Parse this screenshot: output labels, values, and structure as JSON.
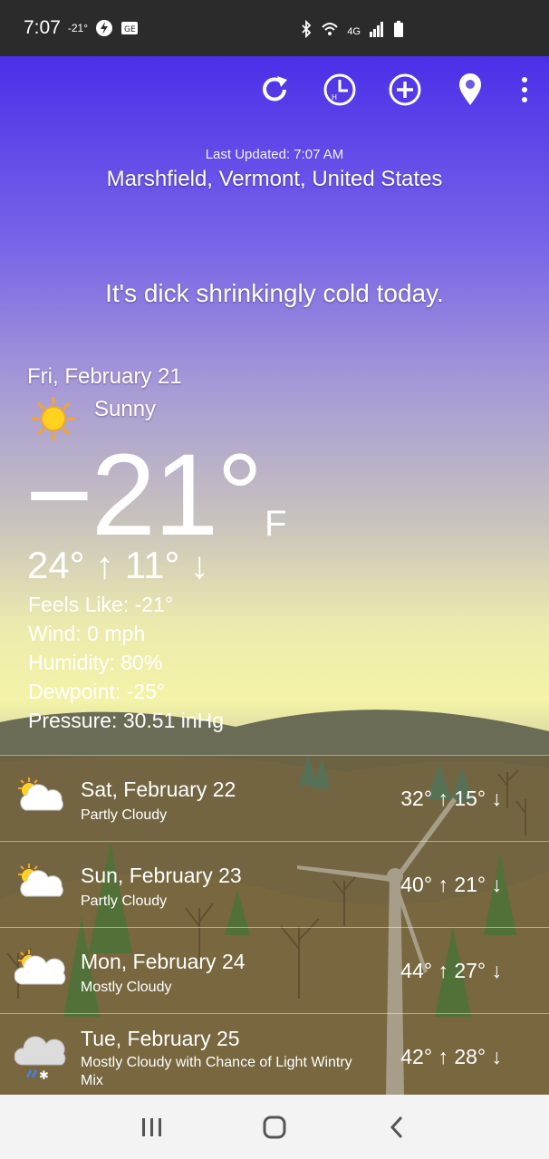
{
  "status_bar": {
    "time": "7:07",
    "temp": "-21°",
    "network_label": "4G"
  },
  "toolbar": {
    "refresh_icon": "refresh-icon",
    "history_icon": "clock-icon",
    "add_icon": "add-circle-icon",
    "location_icon": "location-pin-icon",
    "menu_icon": "more-vert-icon"
  },
  "header": {
    "last_updated": "Last Updated: 7:07 AM",
    "location": "Marshfield, Vermont, United States"
  },
  "tagline": "It's dick shrinkingly cold today.",
  "today": {
    "date": "Fri, February 21",
    "condition": "Sunny",
    "icon": "sun-icon",
    "temp": "−21°",
    "unit": "F",
    "hilo": "24° ↑  11° ↓",
    "feels_like": "Feels Like: -21°",
    "wind": "Wind: 0 mph",
    "humidity": "Humidity: 80%",
    "dewpoint": "Dewpoint: -25°",
    "pressure": "Pressure: 30.51 inHg"
  },
  "forecast": [
    {
      "day": "Sat, February 22",
      "condition": "Partly Cloudy",
      "temps": "32° ↑  15° ↓",
      "icon": "partly-cloudy-icon"
    },
    {
      "day": "Sun, February 23",
      "condition": "Partly Cloudy",
      "temps": "40° ↑  21° ↓",
      "icon": "partly-cloudy-icon"
    },
    {
      "day": "Mon, February 24",
      "condition": "Mostly Cloudy",
      "temps": "44° ↑  27° ↓",
      "icon": "mostly-cloudy-icon"
    },
    {
      "day": "Tue, February 25",
      "condition": "Mostly Cloudy with Chance of Light Wintry Mix",
      "temps": "42° ↑  28° ↓",
      "icon": "wintry-mix-icon"
    }
  ],
  "colors": {
    "sky_top": "#4a2fe8",
    "sky_mid": "#c9c3bd",
    "sky_horizon": "#f4f3a8",
    "hill": "#6b6b52",
    "status_bar": "#2b2b2b",
    "nav_bar": "#f3f3f3"
  }
}
